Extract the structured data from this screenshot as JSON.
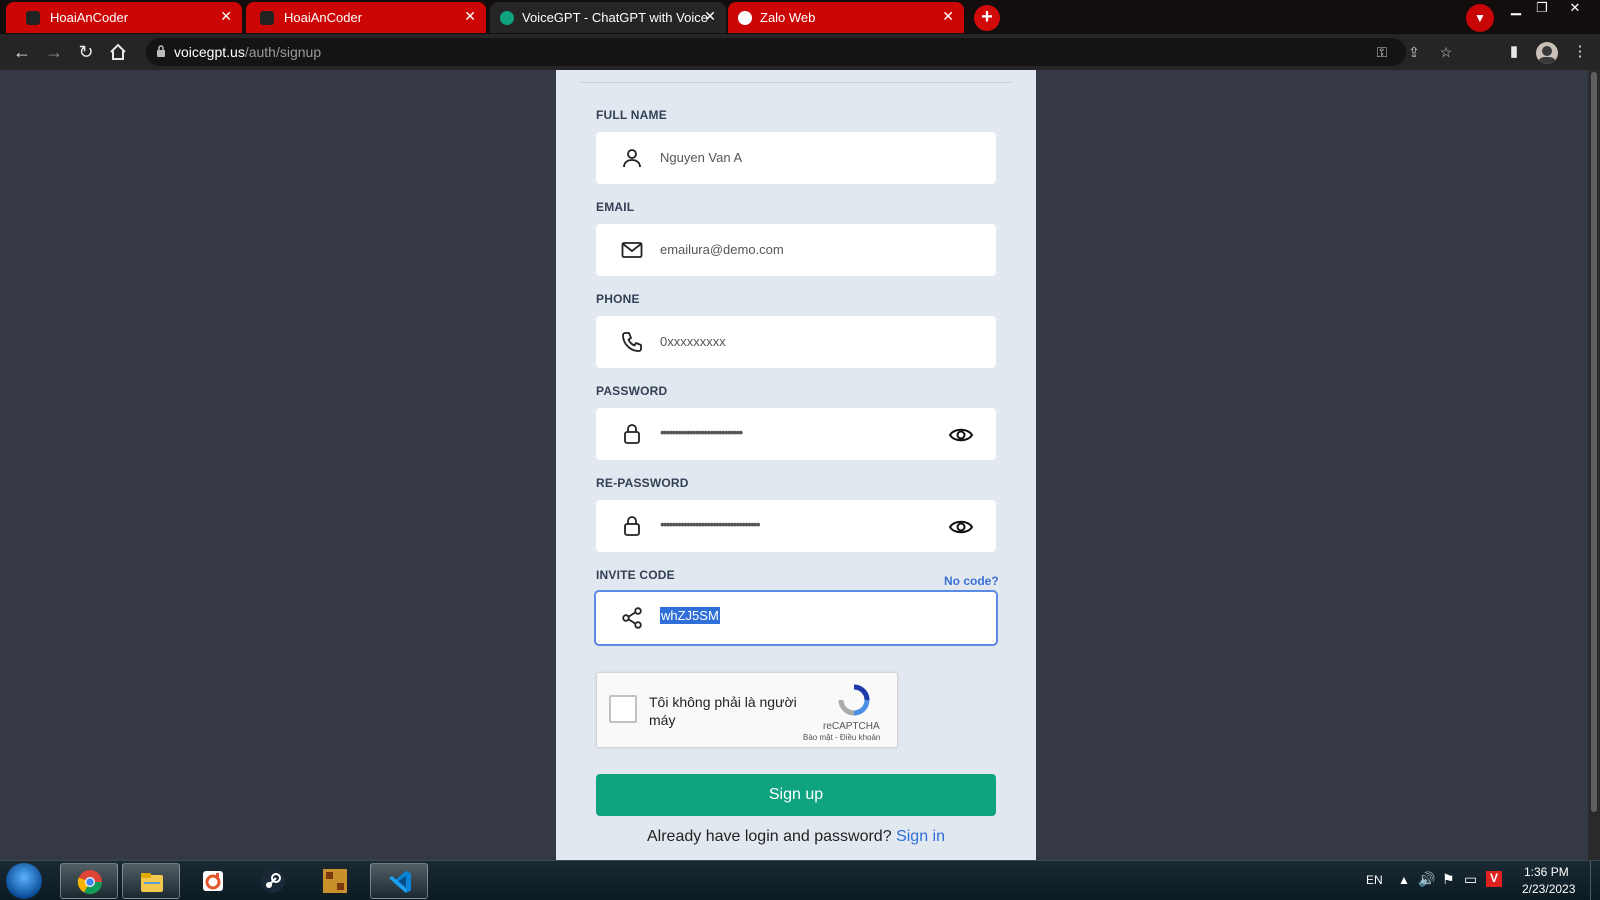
{
  "browser": {
    "tabs": [
      {
        "label": "HoaiAnCoder",
        "favicon": "hoaiancoder-favicon"
      },
      {
        "label": "HoaiAnCoder",
        "favicon": "hoaiancoder-favicon"
      },
      {
        "label": "VoiceGPT - ChatGPT with Voice",
        "favicon": "openai-favicon"
      },
      {
        "label": "Zalo Web",
        "favicon": "zalo-favicon"
      }
    ],
    "url_host": "voicegpt.us",
    "url_path": "/auth/signup",
    "accent_color": "#cc0505"
  },
  "form": {
    "full_name": {
      "label": "FULL NAME",
      "value": "Nguyen Van A",
      "icon": "user-icon"
    },
    "email": {
      "label": "EMAIL",
      "value": "emailura@demo.com",
      "icon": "mail-icon"
    },
    "phone": {
      "label": "PHONE",
      "value": "0xxxxxxxxx",
      "icon": "phone-icon"
    },
    "password": {
      "label": "PASSWORD",
      "value": "••••••••••••••••••••••••••••",
      "icon": "lock-icon"
    },
    "repassword": {
      "label": "RE-PASSWORD",
      "value": "••••••••••••••••••••••••••••••••••",
      "icon": "lock-icon"
    },
    "invite_code": {
      "label": "INVITE CODE",
      "value": "whZJ5SM",
      "no_code_link": "No code?",
      "icon": "share-icon"
    },
    "captcha": {
      "text": "Tôi không phải là người máy",
      "brand": "reCAPTCHA",
      "terms": "Bảo mật - Điều khoản"
    },
    "submit_label": "Sign up",
    "signin_prompt": "Already have login and password?",
    "signin_link": "Sign in",
    "primary_color": "#10a37f"
  },
  "taskbar": {
    "language": "EN",
    "time": "1:36 PM",
    "date": "2/23/2023",
    "apps": [
      "chrome",
      "file-explorer",
      "office",
      "steam",
      "dosbox",
      "vscode"
    ]
  }
}
